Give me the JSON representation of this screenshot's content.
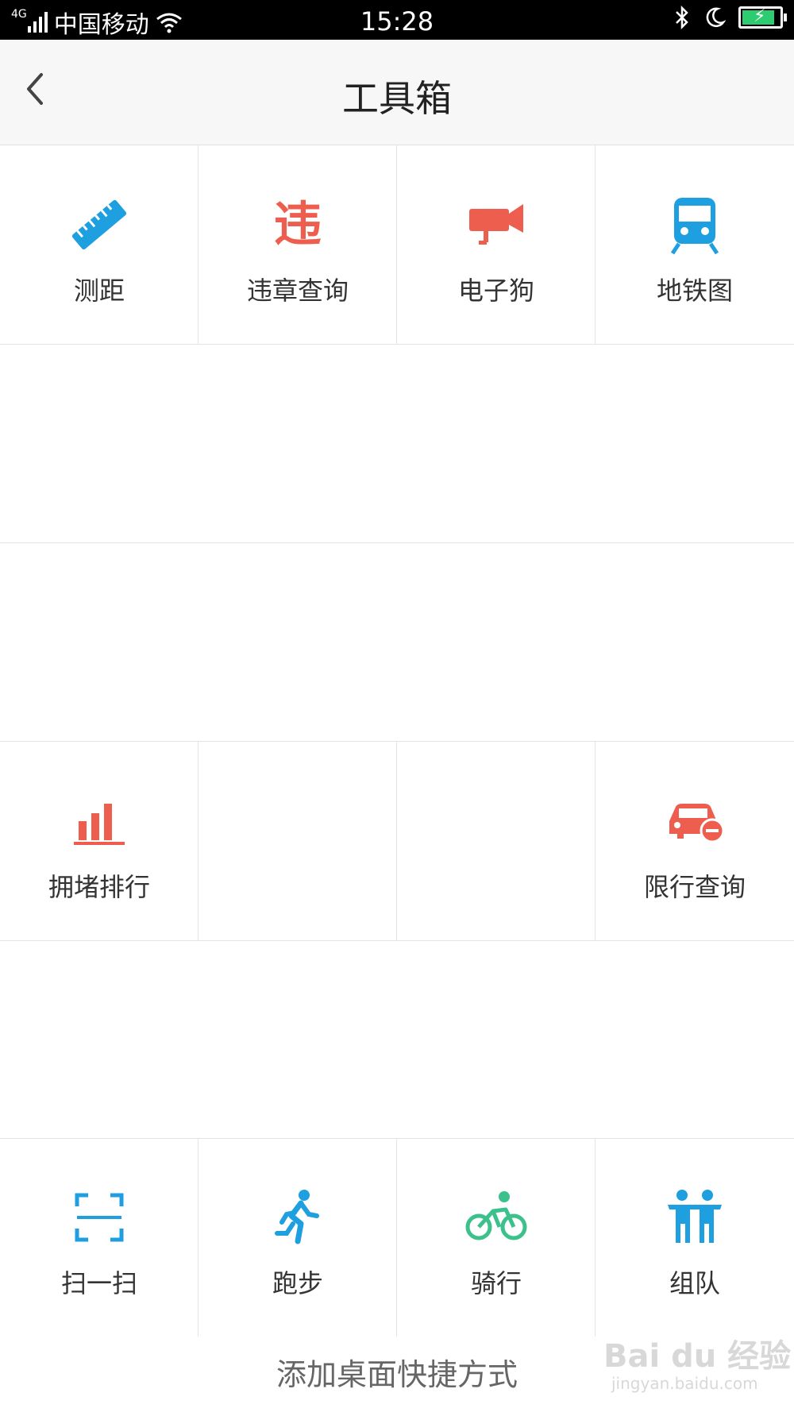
{
  "status_bar": {
    "network": "4G",
    "carrier": "中国移动",
    "time": "15:28"
  },
  "header": {
    "title": "工具箱"
  },
  "tools": [
    {
      "label": "测距",
      "icon": "ruler-icon",
      "color": "#1E9FE0"
    },
    {
      "label": "违章查询",
      "icon": "violation-icon",
      "color": "#EE5E4E",
      "icon_text": "违"
    },
    {
      "label": "电子狗",
      "icon": "camera-icon",
      "color": "#EE5E4E"
    },
    {
      "label": "地铁图",
      "icon": "subway-icon",
      "color": "#1E9FE0"
    },
    {
      "label": "拥堵排行",
      "icon": "bar-chart-icon",
      "color": "#EE5E4E"
    },
    {
      "label": "限行查询",
      "icon": "car-restrict-icon",
      "color": "#EE5E4E"
    },
    {
      "label": "扫一扫",
      "icon": "scan-icon",
      "color": "#1E9FE0"
    },
    {
      "label": "跑步",
      "icon": "running-icon",
      "color": "#1E9FE0"
    },
    {
      "label": "骑行",
      "icon": "cycling-icon",
      "color": "#3CC08C"
    },
    {
      "label": "组队",
      "icon": "team-icon",
      "color": "#1E9FE0"
    }
  ],
  "footer": {
    "add_shortcut": "添加桌面快捷方式"
  },
  "watermark": {
    "text": "Bai du 经验",
    "sub": "jingyan.baidu.com"
  }
}
